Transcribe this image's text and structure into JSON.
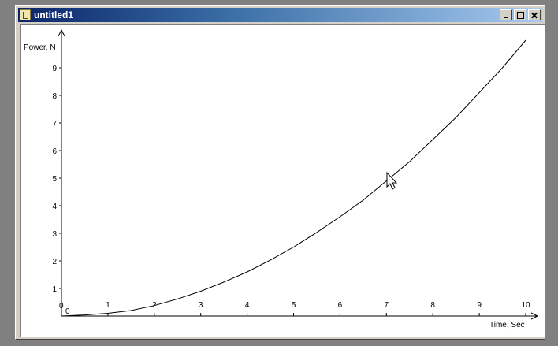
{
  "window": {
    "title": "untitled1",
    "controls": {
      "minimize": "minimize",
      "maximize": "maximize",
      "close": "close"
    }
  },
  "chart_data": {
    "type": "line",
    "xlabel": "Time, Sec",
    "ylabel": "Power, N",
    "origin_labels": {
      "x": "0",
      "y": "0"
    },
    "x_ticks": [
      1,
      2,
      3,
      4,
      5,
      6,
      7,
      8,
      9,
      10
    ],
    "y_ticks": [
      1,
      2,
      3,
      4,
      5,
      6,
      7,
      8,
      9
    ],
    "xlim": [
      0,
      10.3
    ],
    "ylim": [
      0,
      10.0
    ],
    "series": [
      {
        "x": [
          0,
          0.5,
          1,
          1.5,
          2,
          2.5,
          3,
          3.5,
          4,
          4.5,
          5,
          5.5,
          6,
          6.5,
          7,
          7.5,
          8,
          8.5,
          9,
          9.5,
          10
        ],
        "values": [
          0,
          0.04,
          0.1,
          0.2,
          0.38,
          0.62,
          0.9,
          1.23,
          1.6,
          2.03,
          2.5,
          3.03,
          3.6,
          4.2,
          4.9,
          5.6,
          6.4,
          7.2,
          8.1,
          9.0,
          10.0
        ]
      }
    ]
  }
}
